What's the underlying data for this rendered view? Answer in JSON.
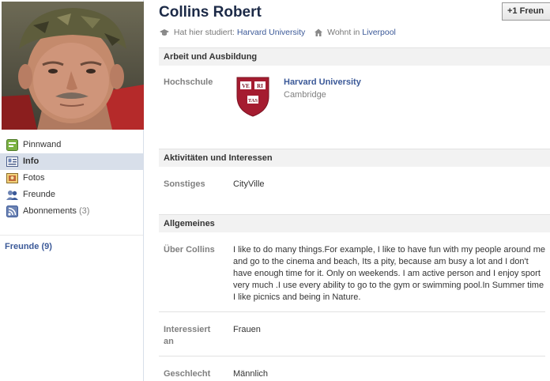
{
  "profile": {
    "name": "Collins Robert",
    "add_friend_label": "+1 Freun",
    "studied_prefix": "Hat hier studiert:",
    "studied_school": "Harvard University",
    "lives_prefix": "Wohnt in",
    "lives_city": "Liverpool"
  },
  "nav": {
    "items": [
      {
        "label": "Pinnwand",
        "icon": "wall-icon"
      },
      {
        "label": "Info",
        "icon": "info-icon",
        "selected": true
      },
      {
        "label": "Fotos",
        "icon": "photos-icon"
      },
      {
        "label": "Freunde",
        "icon": "friends-icon"
      },
      {
        "label": "Abonnements",
        "icon": "subscriptions-icon",
        "count": "(3)"
      }
    ],
    "friends_heading": "Freunde (9)"
  },
  "sections": {
    "work": {
      "title": "Arbeit und Ausbildung",
      "school_label": "Hochschule",
      "school_name": "Harvard University",
      "school_city": "Cambridge",
      "crest_text": [
        "VE",
        "RI",
        "TAS"
      ]
    },
    "activities": {
      "title": "Aktivitäten und Interessen",
      "other_label": "Sonstiges",
      "other_value": "CityVille"
    },
    "general": {
      "title": "Allgemeines",
      "about_label": "Über Collins",
      "about_text": "I like to do many things.For example, I like to have fun with my people around me and go to the cinema and beach, Its a pity, because am busy a lot and I don't have enough time for it. Only on weekends. I am active person and I enjoy sport very much .I use every ability to go to the gym or swimming pool.In Summer time I like picnics and being in Nature.",
      "interested_label": "Interessiert an",
      "interested_value": "Frauen",
      "gender_label": "Geschlecht",
      "gender_value": "Männlich"
    }
  },
  "colors": {
    "link": "#3b5998",
    "name": "#1c2a47",
    "crest": "#a51c30",
    "selected_nav": "#d8dfea"
  }
}
